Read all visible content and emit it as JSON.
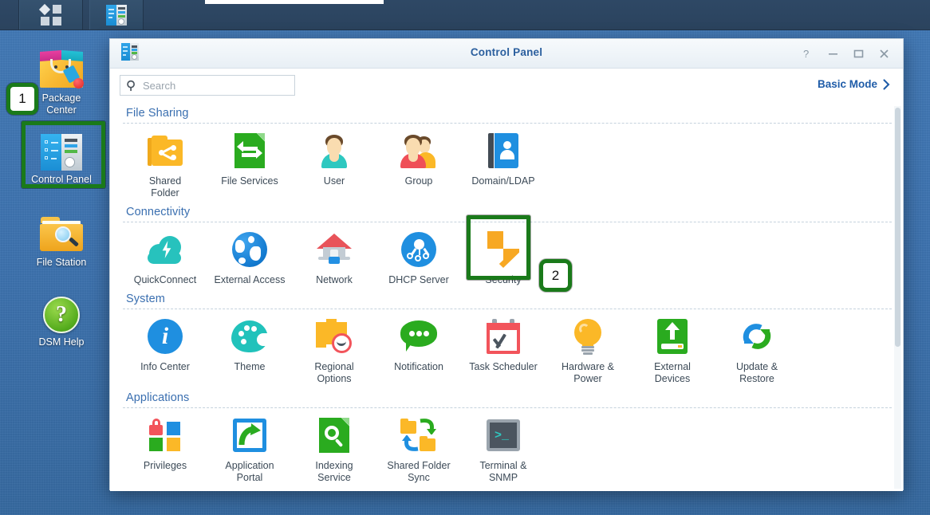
{
  "taskbar": {
    "launcher_label": "main-menu",
    "app_label": "control-panel"
  },
  "desktop": {
    "shortcuts": [
      {
        "label": "Package\nCenter",
        "line1": "Package",
        "line2": "Center",
        "icon": "package-center-icon"
      },
      {
        "label": "Control Panel",
        "line1": "Control Panel",
        "line2": "",
        "icon": "control-panel-icon"
      },
      {
        "label": "File Station",
        "line1": "File Station",
        "line2": "",
        "icon": "file-station-icon"
      },
      {
        "label": "DSM Help",
        "line1": "DSM Help",
        "line2": "",
        "icon": "dsm-help-icon",
        "glyph": "?"
      }
    ]
  },
  "window": {
    "title": "Control Panel",
    "buttons": {
      "help": "?",
      "minimize": "—",
      "maximize": "□",
      "close": "✕"
    },
    "search": {
      "value": "",
      "placeholder": "Search"
    },
    "mode_toggle": {
      "label": "Basic Mode",
      "chevron": "›"
    }
  },
  "sections": [
    {
      "title": "File Sharing",
      "items": [
        {
          "label": "Shared Folder",
          "line1": "Shared",
          "line2": "Folder",
          "icon": "shared-folder-icon"
        },
        {
          "label": "File Services",
          "line1": "File Services",
          "line2": "",
          "icon": "file-services-icon"
        },
        {
          "label": "User",
          "line1": "User",
          "line2": "",
          "icon": "user-icon"
        },
        {
          "label": "Group",
          "line1": "Group",
          "line2": "",
          "icon": "group-icon"
        },
        {
          "label": "Domain/LDAP",
          "line1": "Domain/LDAP",
          "line2": "",
          "icon": "domain-ldap-icon"
        }
      ]
    },
    {
      "title": "Connectivity",
      "items": [
        {
          "label": "QuickConnect",
          "line1": "QuickConnect",
          "line2": "",
          "icon": "quickconnect-icon"
        },
        {
          "label": "External Access",
          "line1": "External Access",
          "line2": "",
          "icon": "external-access-icon"
        },
        {
          "label": "Network",
          "line1": "Network",
          "line2": "",
          "icon": "network-icon"
        },
        {
          "label": "DHCP Server",
          "line1": "DHCP Server",
          "line2": "",
          "icon": "dhcp-server-icon"
        },
        {
          "label": "Security",
          "line1": "Security",
          "line2": "",
          "icon": "security-shield-icon"
        }
      ]
    },
    {
      "title": "System",
      "items": [
        {
          "label": "Info Center",
          "line1": "Info Center",
          "line2": "",
          "icon": "info-center-icon",
          "glyph": "i"
        },
        {
          "label": "Theme",
          "line1": "Theme",
          "line2": "",
          "icon": "theme-icon"
        },
        {
          "label": "Regional Options",
          "line1": "Regional",
          "line2": "Options",
          "icon": "regional-options-icon"
        },
        {
          "label": "Notification",
          "line1": "Notification",
          "line2": "",
          "icon": "notification-icon"
        },
        {
          "label": "Task Scheduler",
          "line1": "Task Scheduler",
          "line2": "",
          "icon": "task-scheduler-icon"
        },
        {
          "label": "Hardware & Power",
          "line1": "Hardware &",
          "line2": "Power",
          "icon": "hardware-power-icon"
        },
        {
          "label": "External Devices",
          "line1": "External",
          "line2": "Devices",
          "icon": "external-devices-icon"
        },
        {
          "label": "Update & Restore",
          "line1": "Update &",
          "line2": "Restore",
          "icon": "update-restore-icon"
        }
      ]
    },
    {
      "title": "Applications",
      "items": [
        {
          "label": "Privileges",
          "line1": "Privileges",
          "line2": "",
          "icon": "privileges-icon"
        },
        {
          "label": "Application Portal",
          "line1": "Application",
          "line2": "Portal",
          "icon": "application-portal-icon"
        },
        {
          "label": "Indexing Service",
          "line1": "Indexing",
          "line2": "Service",
          "icon": "indexing-service-icon"
        },
        {
          "label": "Shared Folder Sync",
          "line1": "Shared Folder",
          "line2": "Sync",
          "icon": "shared-folder-sync-icon"
        },
        {
          "label": "Terminal & SNMP",
          "line1": "Terminal &",
          "line2": "SNMP",
          "icon": "terminal-snmp-icon",
          "glyph": ">_"
        }
      ]
    }
  ],
  "annotations": {
    "highlight_color": "#1a7a1a",
    "badges": [
      {
        "number": "1",
        "target": "control-panel-shortcut"
      },
      {
        "number": "2",
        "target": "security-tile"
      }
    ],
    "boxes": [
      {
        "target": "control-panel-shortcut"
      },
      {
        "target": "security-tile"
      }
    ]
  },
  "colors": {
    "desktop": "#3b72b0",
    "taskbar": "#2e4865",
    "accent_blue": "#1f8fe0",
    "accent_green": "#2aab1f",
    "accent_orange": "#fbb827",
    "title_blue": "#2b5f9e"
  }
}
